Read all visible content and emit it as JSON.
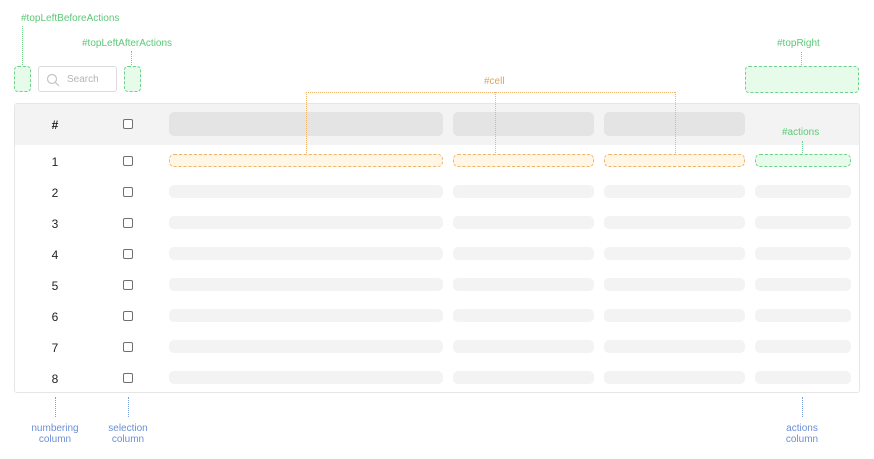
{
  "labels": {
    "top_left_before": "#topLeftBeforeActions",
    "top_left_after": "#topLeftAfterActions",
    "top_right": "#topRight",
    "cell": "#cell",
    "actions": "#actions"
  },
  "search": {
    "placeholder": "Search"
  },
  "table": {
    "header_number": "#",
    "rows": [
      "1",
      "2",
      "3",
      "4",
      "5",
      "6",
      "7",
      "8"
    ]
  },
  "bottom_labels": {
    "numbering": "numbering column",
    "selection": "selection column",
    "actions": "actions column"
  },
  "colors": {
    "green": "#5cc977",
    "orange": "#e0a55a",
    "blue": "#6b8fd6"
  }
}
